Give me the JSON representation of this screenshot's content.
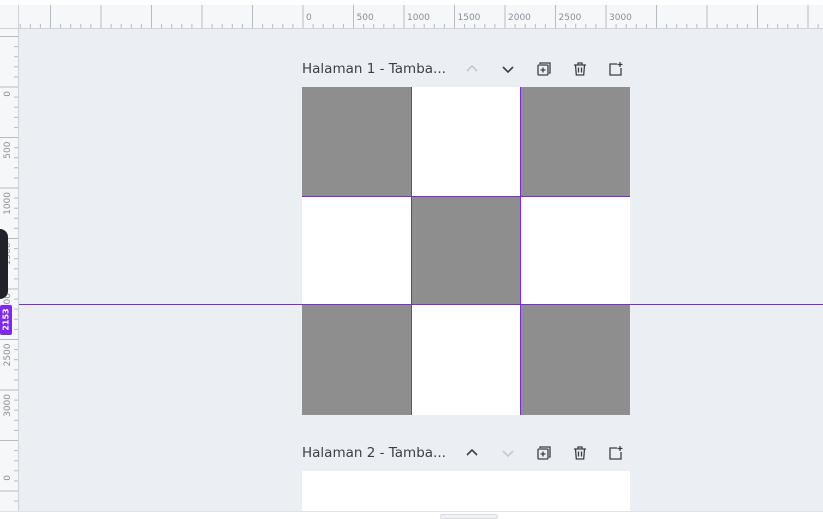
{
  "ruler": {
    "top_labels": [
      "0",
      "500",
      "1000",
      "1500",
      "2000",
      "2500",
      "3000"
    ],
    "left_labels": [
      "0",
      "500",
      "1000",
      "1500",
      "2000",
      "2500",
      "3000",
      "0"
    ]
  },
  "guide": {
    "position_label": "2153"
  },
  "pages": [
    {
      "title": "Halaman 1 - Tamba...",
      "controls": {
        "move_up_enabled": false,
        "move_down_enabled": true
      },
      "grid_pattern": [
        "gray",
        "white",
        "gray",
        "white",
        "gray",
        "white",
        "gray",
        "white",
        "gray"
      ]
    },
    {
      "title": "Halaman 2 - Tamba...",
      "controls": {
        "move_up_enabled": true,
        "move_down_enabled": false
      }
    }
  ],
  "colors": {
    "accent": "#7d2ae8",
    "canvas_background": "#ebeef2",
    "gray_square": "#8e8e8e",
    "icon_active": "#3c3f44",
    "icon_disabled": "#c5c9cf"
  },
  "icons": [
    "chevron-up-icon",
    "chevron-down-icon",
    "duplicate-page-icon",
    "trash-icon",
    "add-page-icon"
  ]
}
